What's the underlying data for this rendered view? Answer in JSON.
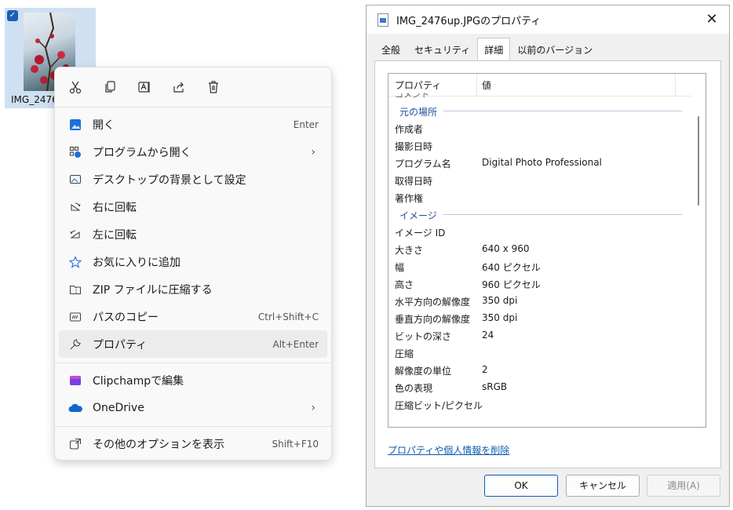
{
  "file": {
    "name": "IMG_2476",
    "checked": true
  },
  "context_menu": {
    "quick_actions": [
      "cut-icon",
      "copy-icon",
      "rename-icon",
      "share-icon",
      "delete-icon"
    ],
    "items": [
      {
        "label": "開く",
        "shortcut": "Enter",
        "icon": "image-open-icon"
      },
      {
        "label": "プログラムから開く",
        "submenu": true,
        "icon": "open-with-icon"
      },
      {
        "label": "デスクトップの背景として設定",
        "icon": "wallpaper-icon"
      },
      {
        "label": "右に回転",
        "icon": "rotate-right-icon"
      },
      {
        "label": "左に回転",
        "icon": "rotate-left-icon"
      },
      {
        "label": "お気に入りに追加",
        "icon": "star-icon"
      },
      {
        "label": "ZIP ファイルに圧縮する",
        "icon": "zip-icon"
      },
      {
        "label": "パスのコピー",
        "shortcut": "Ctrl+Shift+C",
        "icon": "copy-path-icon"
      },
      {
        "label": "プロパティ",
        "shortcut": "Alt+Enter",
        "icon": "wrench-icon"
      },
      {
        "label": "Clipchampで編集",
        "icon": "clipchamp-icon"
      },
      {
        "label": "OneDrive",
        "submenu": true,
        "icon": "onedrive-icon"
      },
      {
        "label": "その他のオプションを表示",
        "shortcut": "Shift+F10",
        "icon": "more-options-icon"
      }
    ]
  },
  "dialog": {
    "title": "IMG_2476up.JPGのプロパティ",
    "tabs": [
      "全般",
      "セキュリティ",
      "詳細",
      "以前のバージョン"
    ],
    "active_tab": "詳細",
    "columns": {
      "property": "プロパティ",
      "value": "値"
    },
    "clipped_top": "コメント",
    "groups": [
      {
        "name": "元の場所",
        "rows": [
          {
            "k": "作成者",
            "v": ""
          },
          {
            "k": "撮影日時",
            "v": ""
          },
          {
            "k": "プログラム名",
            "v": "Digital Photo Professional"
          },
          {
            "k": "取得日時",
            "v": ""
          },
          {
            "k": "著作権",
            "v": ""
          }
        ]
      },
      {
        "name": "イメージ",
        "rows": [
          {
            "k": "イメージ ID",
            "v": ""
          },
          {
            "k": "大きさ",
            "v": "640 x 960"
          },
          {
            "k": "幅",
            "v": "640 ピクセル"
          },
          {
            "k": "高さ",
            "v": "960 ピクセル"
          },
          {
            "k": "水平方向の解像度",
            "v": "350 dpi"
          },
          {
            "k": "垂直方向の解像度",
            "v": "350 dpi"
          },
          {
            "k": "ビットの深さ",
            "v": "24"
          },
          {
            "k": "圧縮",
            "v": ""
          },
          {
            "k": "解像度の単位",
            "v": "2"
          },
          {
            "k": "色の表現",
            "v": "sRGB"
          },
          {
            "k": "圧縮ビット/ピクセル",
            "v": ""
          }
        ]
      }
    ],
    "remove_link": "プロパティや個人情報を削除",
    "buttons": {
      "ok": "OK",
      "cancel": "キャンセル",
      "apply": "適用(A)"
    }
  }
}
